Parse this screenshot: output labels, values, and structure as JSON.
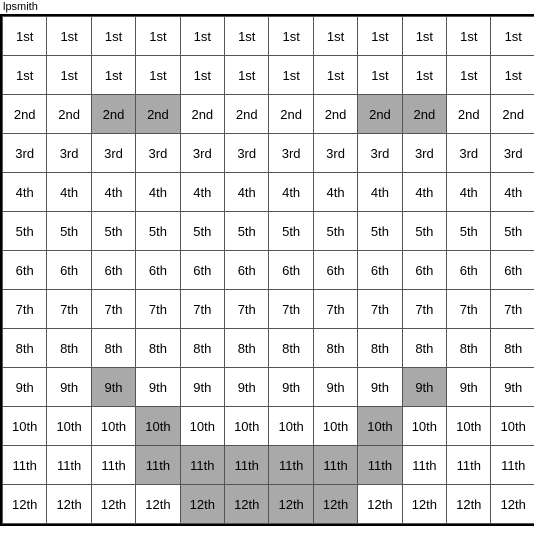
{
  "title": "lpsmith",
  "rows": [
    {
      "label": "1st",
      "cells": [
        false,
        false,
        false,
        false,
        false,
        false,
        false,
        false,
        false,
        false,
        false,
        false
      ]
    },
    {
      "label": "2nd",
      "cells": [
        false,
        false,
        true,
        true,
        false,
        false,
        false,
        false,
        true,
        true,
        false,
        false
      ]
    },
    {
      "label": "3rd",
      "cells": [
        false,
        false,
        false,
        false,
        false,
        false,
        false,
        false,
        false,
        false,
        false,
        false
      ]
    },
    {
      "label": "4th",
      "cells": [
        false,
        false,
        false,
        false,
        false,
        false,
        false,
        false,
        false,
        false,
        false,
        false
      ]
    },
    {
      "label": "5th",
      "cells": [
        false,
        false,
        false,
        false,
        false,
        false,
        false,
        false,
        false,
        false,
        false,
        false
      ]
    },
    {
      "label": "6th",
      "cells": [
        false,
        false,
        false,
        false,
        false,
        false,
        false,
        false,
        false,
        false,
        false,
        false
      ]
    },
    {
      "label": "7th",
      "cells": [
        false,
        false,
        false,
        false,
        false,
        false,
        false,
        false,
        false,
        false,
        false,
        false
      ]
    },
    {
      "label": "8th",
      "cells": [
        false,
        false,
        false,
        false,
        false,
        false,
        false,
        false,
        false,
        false,
        false,
        false
      ]
    },
    {
      "label": "9th",
      "cells": [
        false,
        false,
        true,
        false,
        false,
        false,
        false,
        false,
        false,
        true,
        false,
        false
      ]
    },
    {
      "label": "10th",
      "cells": [
        false,
        false,
        false,
        true,
        false,
        false,
        false,
        false,
        true,
        false,
        false,
        false
      ]
    },
    {
      "label": "11th",
      "cells": [
        false,
        false,
        false,
        true,
        true,
        true,
        true,
        true,
        true,
        false,
        false,
        false
      ]
    },
    {
      "label": "12th",
      "cells": [
        false,
        false,
        false,
        false,
        true,
        true,
        true,
        true,
        false,
        false,
        false,
        false
      ]
    }
  ],
  "cols": 12
}
